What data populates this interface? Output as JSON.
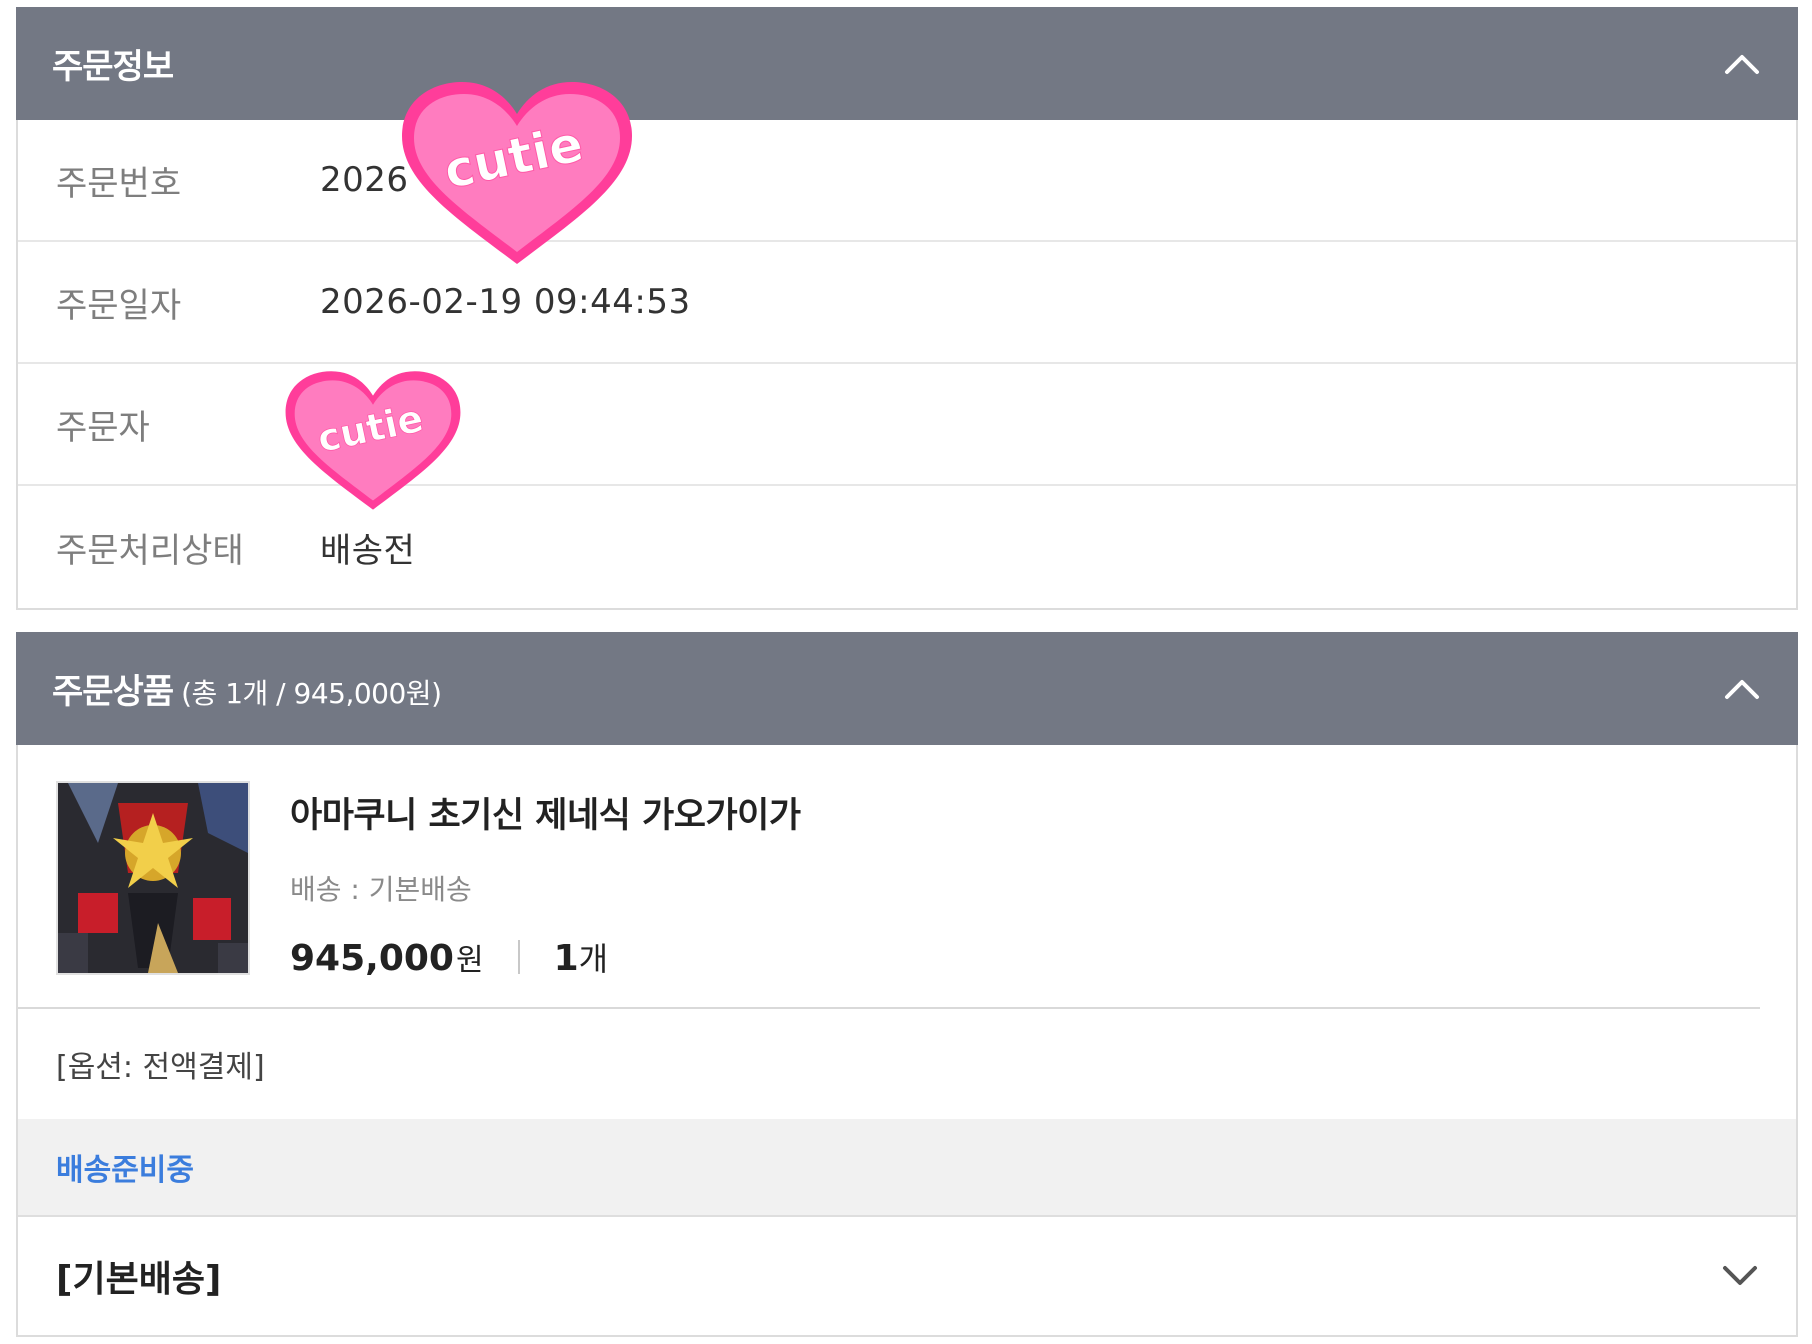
{
  "order_info": {
    "title": "주문정보",
    "collapse_icon": "chevron-up-icon",
    "rows": [
      {
        "label": "주문번호",
        "value": "2026"
      },
      {
        "label": "주문일자",
        "value": "2026-02-19 09:44:53"
      },
      {
        "label": "주문자",
        "value": ""
      },
      {
        "label": "주문처리상태",
        "value": "배송전"
      }
    ]
  },
  "stickers": {
    "text": "cutie",
    "fill": "#ff6fb7",
    "rim": "#ff3d9a"
  },
  "order_products": {
    "title": "주문상품",
    "summary": "(총 1개 / 945,000원)",
    "collapse_icon": "chevron-up-icon",
    "item": {
      "name": "아마쿠니 초기신 제네식 가오가이가",
      "shipping": "배송 : 기본배송",
      "price": "945,000",
      "price_unit": "원",
      "qty": "1",
      "qty_unit": "개",
      "option": "[옵션: 전액결제]"
    },
    "status": "배송준비중",
    "shipping_method": "[기본배송]",
    "expand_icon": "chevron-down-icon"
  },
  "colors": {
    "header_bg": "#737884",
    "status_text": "#3b7ddd"
  }
}
